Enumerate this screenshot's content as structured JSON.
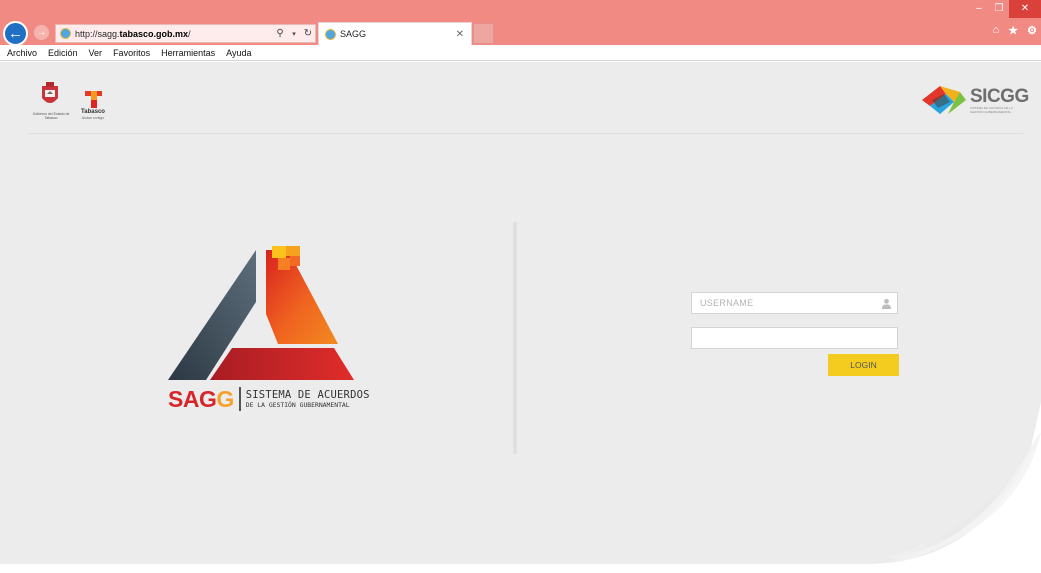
{
  "browser": {
    "address_prefix": "http://sagg.",
    "address_bold": "tabasco.gob.mx",
    "address_suffix": "/",
    "tab_title": "SAGG",
    "window_controls": {
      "minimize": "–",
      "restore": "❐",
      "close": "✕"
    },
    "icons": [
      "back-arrow-icon",
      "forward-arrow-icon",
      "ie-icon",
      "search-icon",
      "refresh-icon",
      "close-icon",
      "home-icon",
      "star-icon",
      "gear-icon"
    ]
  },
  "menu": [
    "Archivo",
    "Edición",
    "Ver",
    "Favoritos",
    "Herramientas",
    "Ayuda"
  ],
  "header": {
    "gov_caption": "Gobierno del Estado de Tabasco",
    "tabasco_word": "Tabasco",
    "tabasco_sub": "Andan contigo",
    "sicgg_word": "SICGG",
    "sicgg_sub": "SISTEMA DE CONTROL DE LA GESTIÓN GUBERNAMENTAL"
  },
  "brand": {
    "word_main": "SAG",
    "word_accent": "G",
    "tagline_1": "SISTEMA DE ACUERDOS",
    "tagline_2": "DE LA GESTIÓN GUBERNAMENTAL",
    "colors": {
      "red": "#d7262b",
      "orange": "#f5a22b",
      "slate": "#3c4a55",
      "yellow": "#f3cc1f"
    }
  },
  "login": {
    "username_placeholder": "USERNAME",
    "username_value": "",
    "password_value": "",
    "button_label": "LOGIN"
  }
}
